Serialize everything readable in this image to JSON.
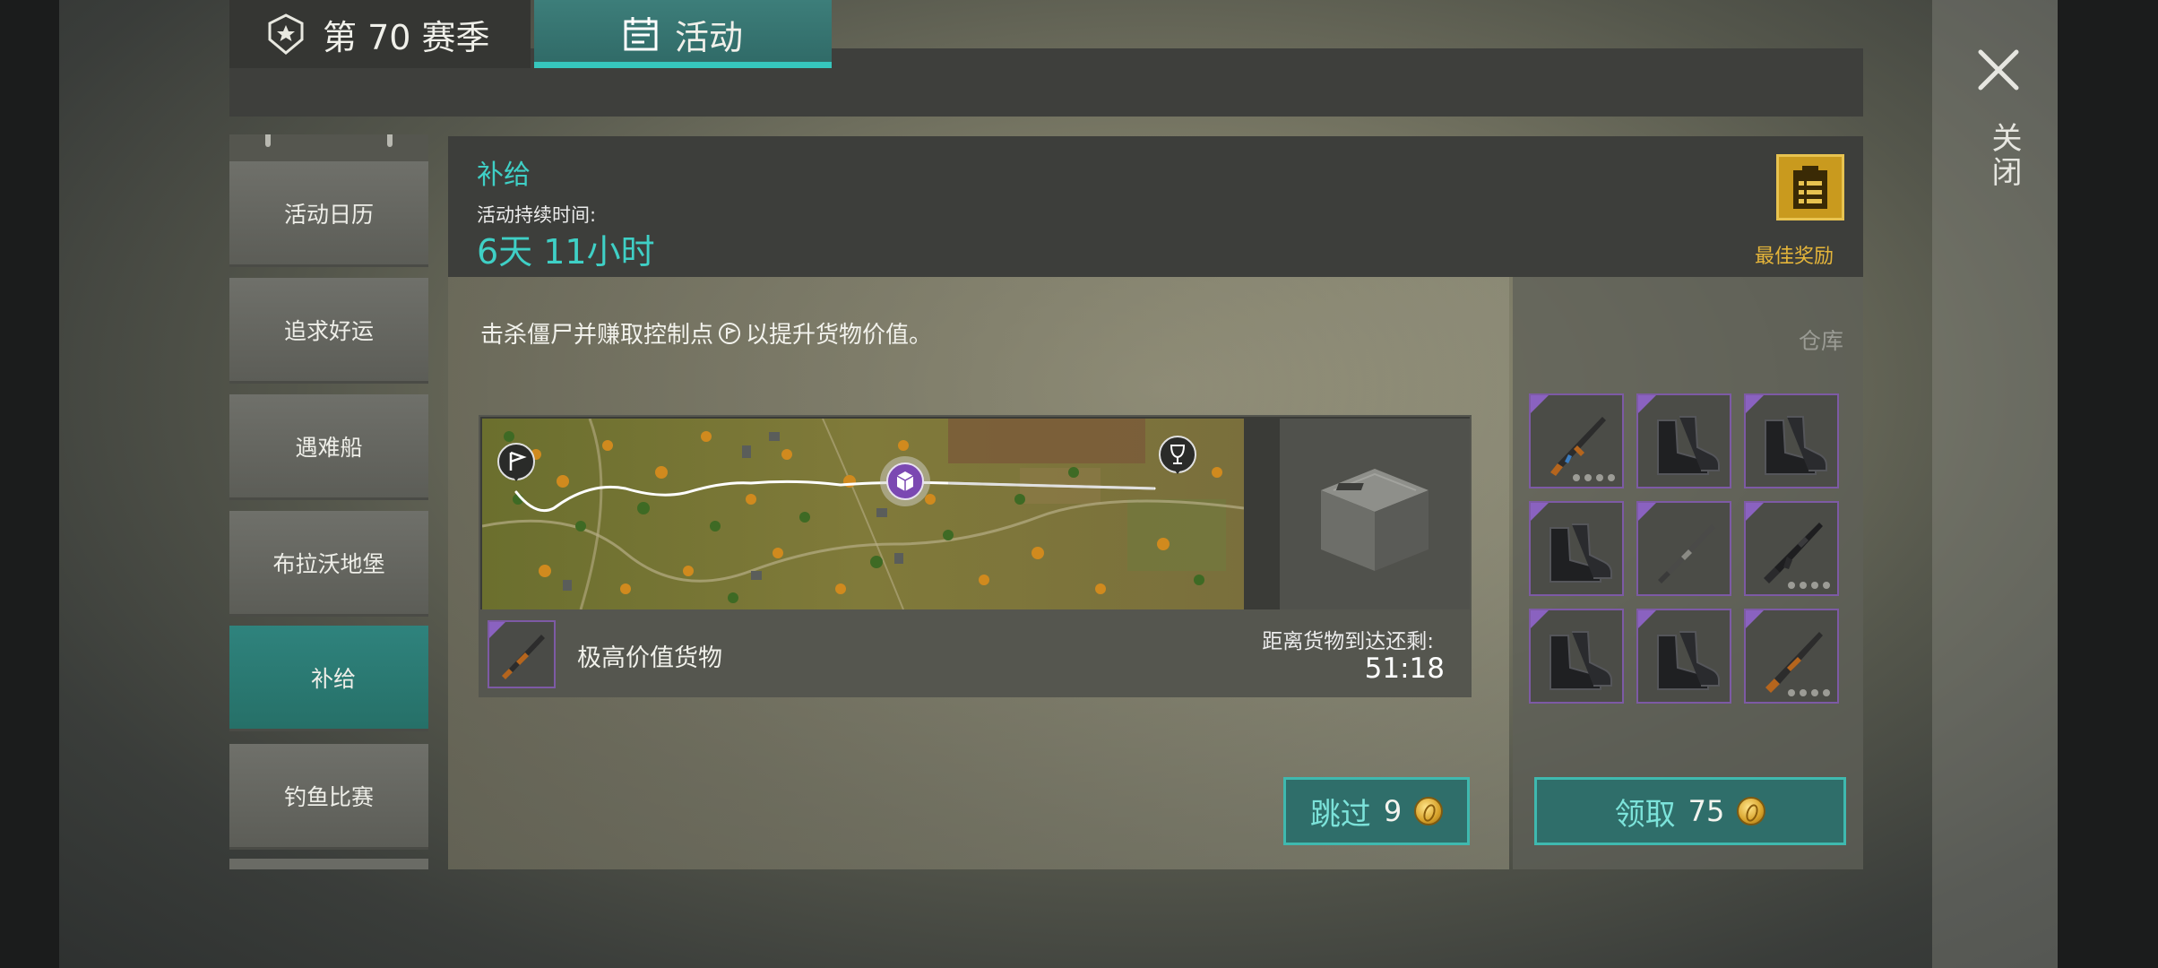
{
  "tabs": {
    "season_label": "第 70 赛季",
    "event_label": "活动"
  },
  "sidebar": {
    "items": [
      {
        "label": "活动日历"
      },
      {
        "label": "追求好运"
      },
      {
        "label": "遇难船"
      },
      {
        "label": "布拉沃地堡"
      },
      {
        "label": "补给",
        "active": true
      },
      {
        "label": "钓鱼比赛"
      }
    ]
  },
  "header": {
    "title": "补给",
    "duration_label": "活动持续时间:",
    "duration_value": "6天 11小时",
    "best_reward_label": "最佳奖励"
  },
  "main": {
    "description_before": "击杀僵尸并赚取控制点",
    "description_after": "以提升货物价值。",
    "cargo_name": "极高价值货物",
    "eta_label": "距离货物到达还剩:",
    "eta_value": "51:18",
    "skip_label": "跳过",
    "skip_cost": "9"
  },
  "warehouse": {
    "label": "仓库",
    "items": [
      {
        "icon": "rifle-ak-icon",
        "tier_dots": 4
      },
      {
        "icon": "boots-icon"
      },
      {
        "icon": "boots-icon"
      },
      {
        "icon": "boots-icon"
      },
      {
        "icon": "shotgun-icon"
      },
      {
        "icon": "assault-rifle-icon",
        "tier_dots": 4
      },
      {
        "icon": "boots-icon"
      },
      {
        "icon": "boots-icon"
      },
      {
        "icon": "hunting-rifle-icon",
        "tier_dots": 4
      }
    ],
    "claim_label": "领取",
    "claim_cost": "75"
  },
  "close_label": "关闭",
  "colors": {
    "accent_teal": "#3fd0c6",
    "active_tab": "#2f837d",
    "gold": "#c99a1e",
    "rarity_purple": "#8a62c0"
  }
}
